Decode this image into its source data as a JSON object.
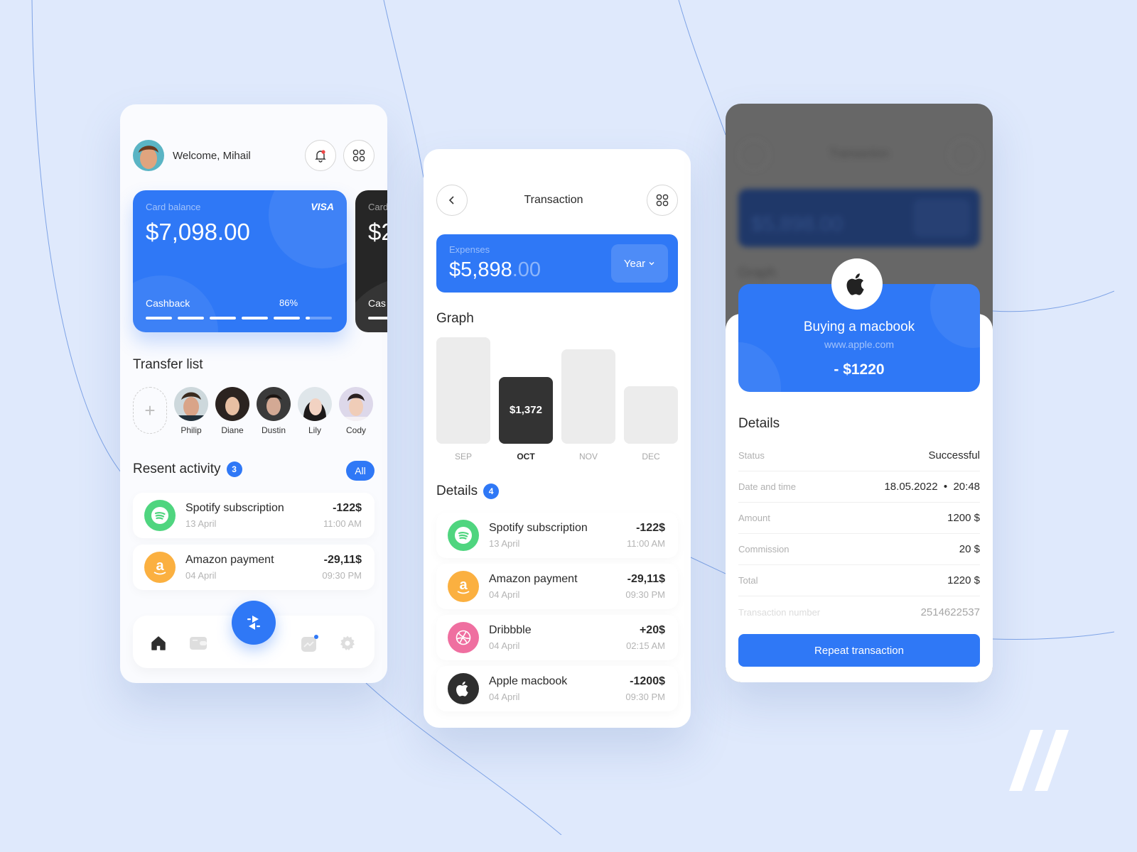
{
  "colors": {
    "background": "#dfe9fc",
    "accent": "#2f78f6",
    "dark_card": "#262626",
    "spotify": "#4fd57f",
    "amazon": "#fbb040",
    "dribbble": "#ef6fa0",
    "apple": "#2e2e2e"
  },
  "home": {
    "welcome": "Welcome, Mihail",
    "icons": {
      "notifications": "bell-icon",
      "menu": "grid-icon"
    },
    "cards": [
      {
        "label": "Card balance",
        "brand": "VISA",
        "balance": "$7,098.00",
        "cashback_label": "Cashback",
        "cashback_percent_label": "86%",
        "cashback_progress": 0.86
      },
      {
        "label": "Card",
        "balance": "$2",
        "cashback_label": "Cas"
      }
    ],
    "transfer_title": "Transfer list",
    "add_contact_icon": "plus-icon",
    "contacts": [
      {
        "name": "Philip"
      },
      {
        "name": "Diane"
      },
      {
        "name": "Dustin"
      },
      {
        "name": "Lily"
      },
      {
        "name": "Cody"
      }
    ],
    "activity_title": "Resent activity",
    "activity_count": "3",
    "all_label": "All",
    "activity": [
      {
        "icon": "spotify-icon",
        "name": "Spotify subscription",
        "date": "13 April",
        "amount": "-122$",
        "time": "11:00 AM"
      },
      {
        "icon": "amazon-icon",
        "name": "Amazon payment",
        "date": "04 April",
        "amount": "-29,11$",
        "time": "09:30 PM"
      }
    ],
    "nav": [
      "home-icon",
      "wallet-icon",
      "transfer-icon",
      "chart-icon",
      "settings-icon"
    ]
  },
  "transaction": {
    "title": "Transaction",
    "expenses_label": "Expenses",
    "expenses_whole": "$5,898",
    "expenses_decimal": ".00",
    "period": "Year",
    "graph_title": "Graph",
    "details_title": "Details",
    "details_count": "4",
    "items": [
      {
        "icon": "spotify-icon",
        "name": "Spotify subscription",
        "date": "13 April",
        "amount": "-122$",
        "time": "11:00 AM"
      },
      {
        "icon": "amazon-icon",
        "name": "Amazon payment",
        "date": "04 April",
        "amount": "-29,11$",
        "time": "09:30 PM"
      },
      {
        "icon": "dribbble-icon",
        "name": "Dribbble",
        "date": "04 April",
        "amount": "+20$",
        "time": "02:15 AM"
      },
      {
        "icon": "apple-icon",
        "name": "Apple macbook",
        "date": "04 April",
        "amount": "-1200$",
        "time": "09:30 PM"
      }
    ]
  },
  "chart_data": {
    "type": "bar",
    "title": "Graph",
    "categories": [
      "SEP",
      "OCT",
      "NOV",
      "DEC"
    ],
    "values": [
      1780,
      1120,
      1580,
      960
    ],
    "highlighted": "OCT",
    "highlight_label": "$1,372",
    "xlabel": "",
    "ylabel": "",
    "grid": false,
    "legend": "none"
  },
  "receipt": {
    "title": "Buying a macbook",
    "url": "www.apple.com",
    "amount": "- $1220",
    "details_title": "Details",
    "rows": [
      {
        "key": "Status",
        "value": "Successful"
      },
      {
        "key": "Date and time",
        "value": "18.05.2022  •  20:48"
      },
      {
        "key": "Amount",
        "value": "1200 $"
      },
      {
        "key": "Commission",
        "value": "20 $"
      },
      {
        "key": "Total",
        "value": "1220 $"
      },
      {
        "key": "Transaction number",
        "value": "2514622537"
      }
    ],
    "repeat_label": "Repeat transaction",
    "background": {
      "title": "Transaction",
      "amount": "$5,898.00",
      "graph": "Graph"
    }
  }
}
